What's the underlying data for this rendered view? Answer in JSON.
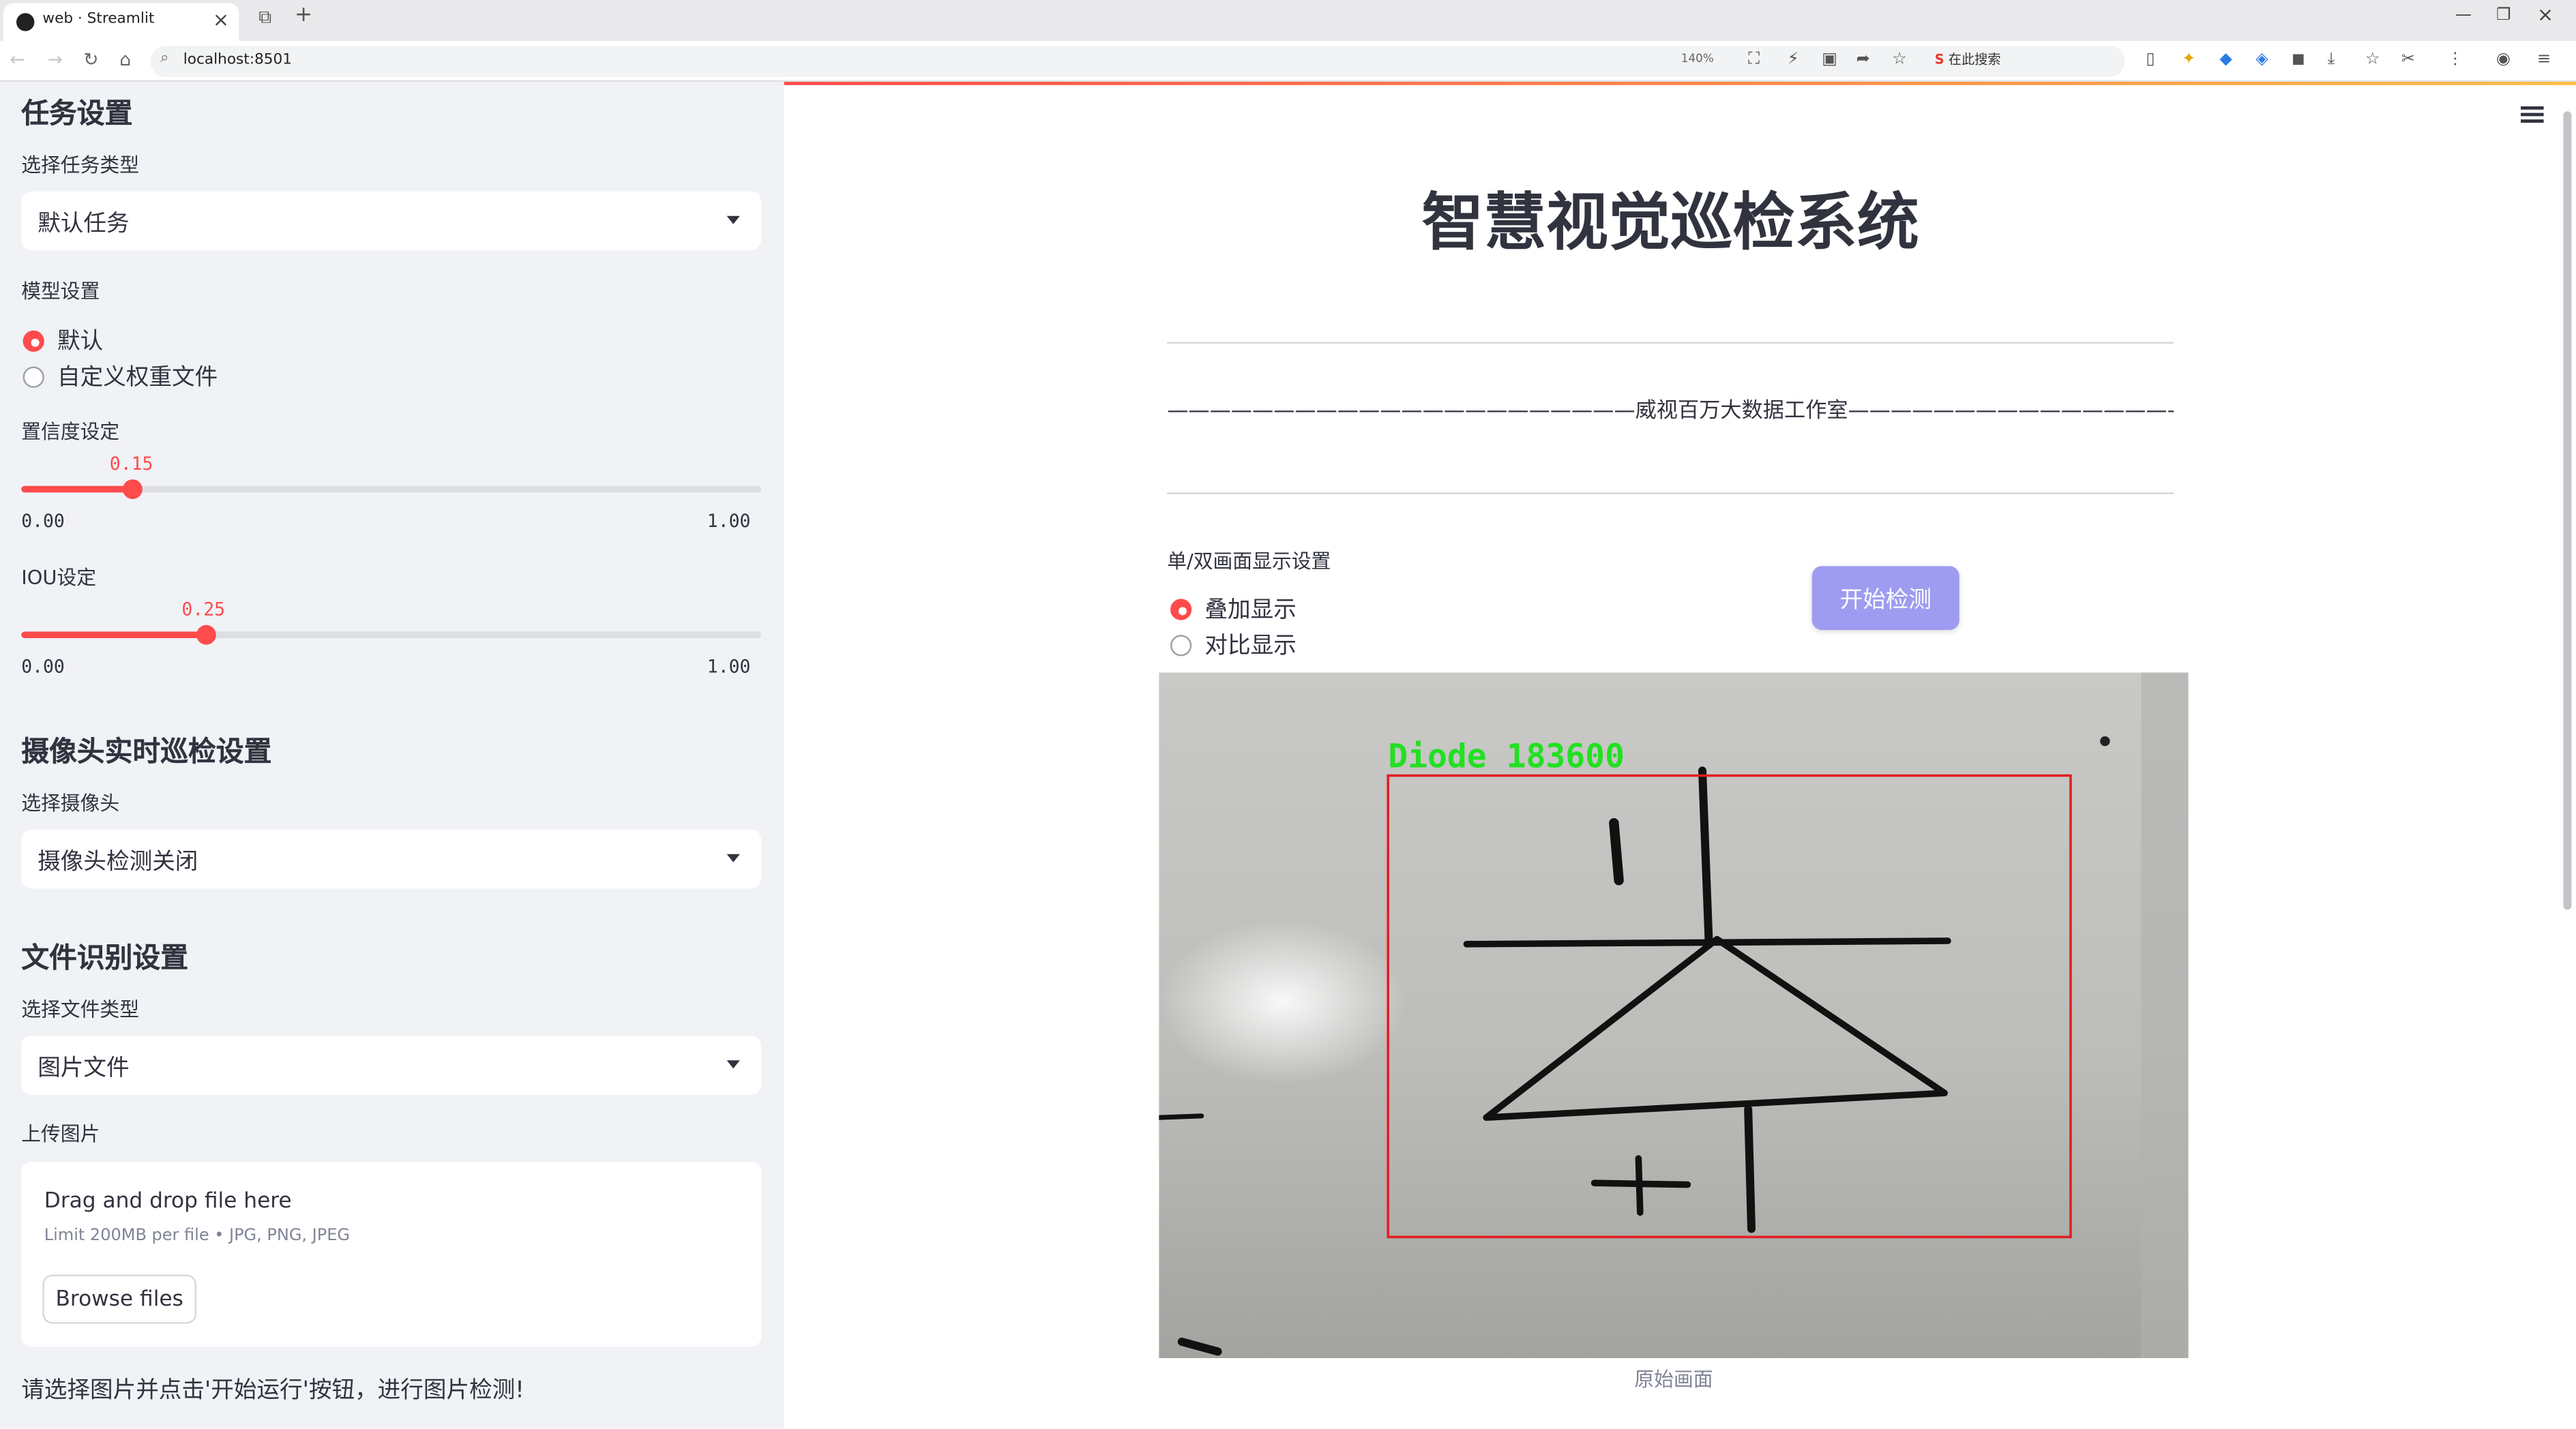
{
  "browser": {
    "tab_title": "web · Streamlit",
    "url": "localhost:8501",
    "zoom": "140%",
    "search_engine_label": "在此搜索"
  },
  "sidebar": {
    "task_section": {
      "heading": "任务设置",
      "select_label": "选择任务类型",
      "select_value": "默认任务"
    },
    "model_section": {
      "label": "模型设置",
      "options": [
        "默认",
        "自定义权重文件"
      ],
      "selected": 0
    },
    "confidence": {
      "label": "置信度设定",
      "value": "0.15",
      "min": "0.00",
      "max": "1.00",
      "fraction": 0.15
    },
    "iou": {
      "label": "IOU设定",
      "value": "0.25",
      "min": "0.00",
      "max": "1.00",
      "fraction": 0.25
    },
    "camera_section": {
      "heading": "摄像头实时巡检设置",
      "select_label": "选择摄像头",
      "select_value": "摄像头检测关闭"
    },
    "file_section": {
      "heading": "文件识别设置",
      "select_label": "选择文件类型",
      "select_value": "图片文件",
      "upload_label": "上传图片",
      "drop_text": "Drag and drop file here",
      "limit_text": "Limit 200MB per file • JPG, PNG, JPEG",
      "browse_label": "Browse files"
    },
    "hint": "请选择图片并点击'开始运行'按钮，进行图片检测!"
  },
  "main": {
    "title": "智慧视觉巡检系统",
    "subtitle": "——————————————————————威视百万大数据工作室————————————————————————",
    "display_label": "单/双画面显示设置",
    "display_options": [
      "叠加显示",
      "对比显示"
    ],
    "display_selected": 0,
    "start_button": "开始检测",
    "detection_label": "Diode 183600",
    "caption": "原始画面"
  },
  "colors": {
    "accent": "#ff4b4b",
    "button": "#9e9cf0",
    "detection_box": "#e02020",
    "detection_text": "#22e022"
  }
}
